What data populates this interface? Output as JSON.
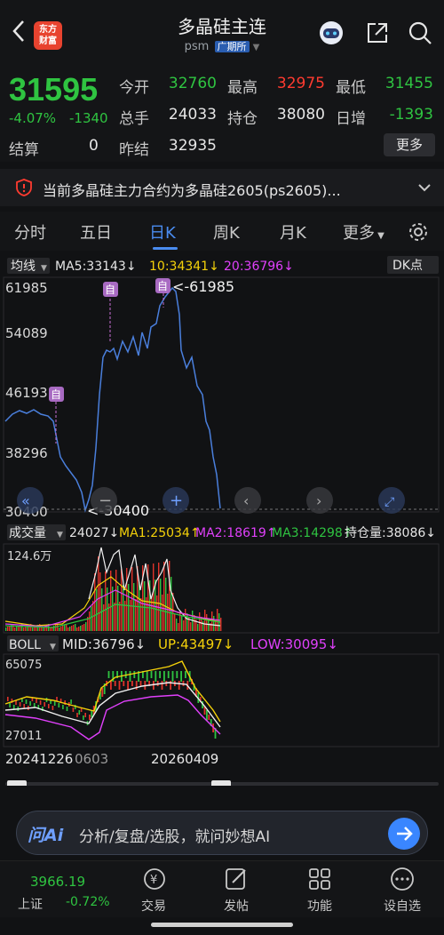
{
  "header": {
    "logo_text_line1": "东方",
    "logo_text_line2": "财富",
    "title": "多晶硅主连",
    "code": "psm",
    "exchange": "广期所"
  },
  "quote": {
    "last_price": "31595",
    "change_pct": "-4.07%",
    "change_abs": "-1340",
    "fields": {
      "open_label": "今开",
      "open_value": "32760",
      "high_label": "最高",
      "high_value": "32975",
      "low_label": "最低",
      "low_value": "31455",
      "volume_label": "总手",
      "volume_value": "24033",
      "oi_label": "持仓",
      "oi_value": "38080",
      "oi_change_label": "日增",
      "oi_change_value": "-1393"
    },
    "settle_label": "结算",
    "settle_value": "0",
    "prev_settle_label": "昨结",
    "prev_settle_value": "32935",
    "more_label": "更多"
  },
  "notice": {
    "text": "当前多晶硅主力合约为多晶硅2605(ps2605)..."
  },
  "tabs": [
    "分时",
    "五日",
    "日K",
    "周K",
    "月K",
    "更多"
  ],
  "active_tab": "日K",
  "kline": {
    "ma_selector": "均线",
    "ma5": "MA5:33143↓",
    "ma10": "10:34341↓",
    "ma20": "20:36796↓",
    "dk_label": "DK点",
    "y_ticks": [
      "61985",
      "54089",
      "46193",
      "38296",
      "30400"
    ],
    "max_label": "<-61985",
    "min_label": "<-30400",
    "marker_text": "自"
  },
  "volume": {
    "selector": "成交量",
    "value": "24027↓",
    "ma1": "MA1:25034↑",
    "ma2": "MA2:18619↑",
    "ma3": "MA3:14298↑",
    "oi": "持仓量:38086↓",
    "scale": "124.6万"
  },
  "boll": {
    "selector": "BOLL",
    "mid": "MID:36796↓",
    "up": "UP:43497↓",
    "low": "LOW:30095↓",
    "top": "65075",
    "bottom": "27011",
    "date_start": "20241226",
    "date_mid": "0603",
    "date_end": "20260409"
  },
  "ask": {
    "logo": "问Ai",
    "text": "分析/复盘/选股，就问妙想AI"
  },
  "bottom_nav": {
    "index_value": "3966.19",
    "index_name": "上证",
    "index_change": "-0.72%",
    "items": [
      "交易",
      "发帖",
      "功能",
      "设自选"
    ]
  },
  "colors": {
    "up": "#ff3b30",
    "down": "#2fc441",
    "accent": "#4a8cf0",
    "ma10": "#f5d20a",
    "ma20": "#e040fb"
  }
}
